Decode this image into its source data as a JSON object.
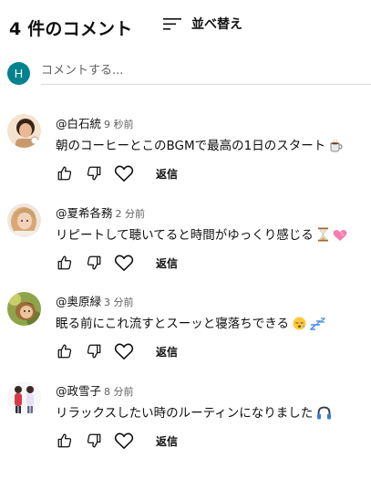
{
  "header": {
    "count_label": "4 件のコメント",
    "sort_label": "並べ替え",
    "sort_icon": "sort-icon"
  },
  "compose": {
    "avatar_initial": "H",
    "avatar_color": "#00838f",
    "placeholder": "コメントする..."
  },
  "comments": [
    {
      "user": "@白石統",
      "time": "9 秒前",
      "text": "朝のコーヒーとこのBGMで最高の1日のスタート",
      "emoji": "coffee-icon",
      "reply": "返信"
    },
    {
      "user": "@夏希各務",
      "time": "2 分前",
      "text": "リピートして聴いてると時間がゆっくり感じる",
      "emoji": "hourglass-icon",
      "emoji2": "heart-emoji-icon",
      "reply": "返信"
    },
    {
      "user": "@奥原緑",
      "time": "3 分前",
      "text": "眠る前にこれ流すとスーッと寝落ちできる",
      "emoji": "sleepy-face-icon",
      "emoji2": "zzz-icon",
      "reply": "返信"
    },
    {
      "user": "@政雪子",
      "time": "8 分前",
      "text": "リラックスしたい時のルーティンになりました",
      "emoji": "headphones-icon",
      "reply": "返信"
    }
  ],
  "actions": {
    "like_icon": "thumbs-up-icon",
    "dislike_icon": "thumbs-down-icon",
    "heart_icon": "heart-icon"
  }
}
